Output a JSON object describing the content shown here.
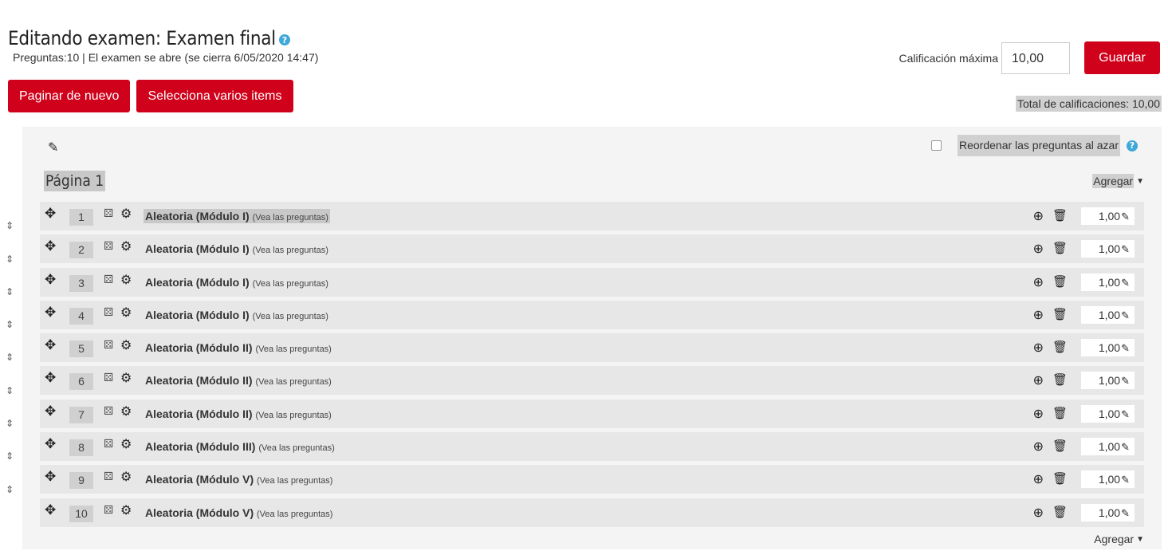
{
  "header": {
    "title": "Editando examen: Examen final",
    "help_icon": "question-circle-icon",
    "summary": "Preguntas:10 | El examen se abre (se cierra 6/05/2020 14:47)"
  },
  "grading": {
    "max_label": "Calificación máxima",
    "max_value": "10,00",
    "save_label": "Guardar",
    "total": "Total de calificaciones: 10,00"
  },
  "actions": {
    "repaginate": "Paginar de nuevo",
    "select_multiple": "Selecciona varios items"
  },
  "section": {
    "edit_icon": "pencil-icon",
    "shuffle_label": "Reordenar las preguntas al azar",
    "page_heading": "Página 1",
    "add_label": "Agregar",
    "questions": [
      {
        "num": "1",
        "name": "Aleatoria (Módulo I)",
        "note": "(Vea las preguntas)",
        "mark": "1,00"
      },
      {
        "num": "2",
        "name": "Aleatoria (Módulo I)",
        "note": "(Vea las preguntas)",
        "mark": "1,00"
      },
      {
        "num": "3",
        "name": "Aleatoria (Módulo I)",
        "note": "(Vea las preguntas)",
        "mark": "1,00"
      },
      {
        "num": "4",
        "name": "Aleatoria (Módulo I)",
        "note": "(Vea las preguntas)",
        "mark": "1,00"
      },
      {
        "num": "5",
        "name": "Aleatoria (Módulo II)",
        "note": "(Vea las preguntas)",
        "mark": "1,00"
      },
      {
        "num": "6",
        "name": "Aleatoria (Módulo II)",
        "note": "(Vea las preguntas)",
        "mark": "1,00"
      },
      {
        "num": "7",
        "name": "Aleatoria (Módulo II)",
        "note": "(Vea las preguntas)",
        "mark": "1,00"
      },
      {
        "num": "8",
        "name": "Aleatoria (Módulo III)",
        "note": "(Vea las preguntas)",
        "mark": "1,00"
      },
      {
        "num": "9",
        "name": "Aleatoria (Módulo V)",
        "note": "(Vea las preguntas)",
        "mark": "1,00"
      },
      {
        "num": "10",
        "name": "Aleatoria (Módulo V)",
        "note": "(Vea las preguntas)",
        "mark": "1,00"
      }
    ]
  },
  "colors": {
    "primary": "#d0021b",
    "help": "#3fa8d8",
    "row_bg": "#e7e7e7",
    "panel_bg": "#f4f4f4"
  }
}
